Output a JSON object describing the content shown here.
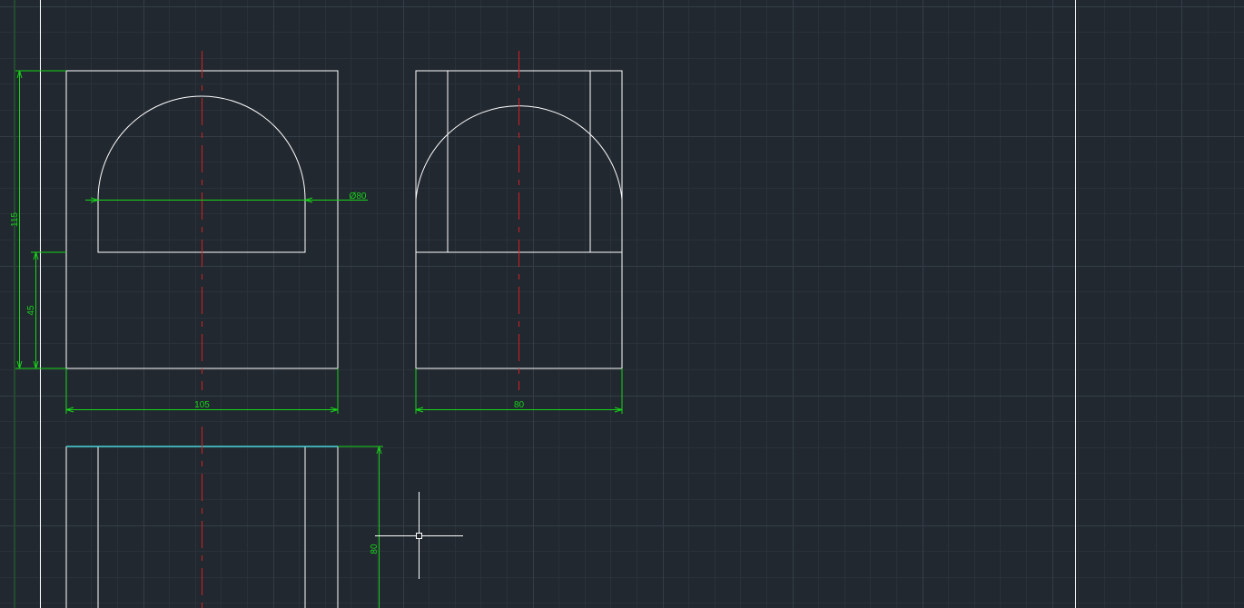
{
  "colors": {
    "background": "#212830",
    "grid_minor": "#2a3139",
    "grid_major": "#343d46",
    "geometry": "#ffffff",
    "center_line": "#d42020",
    "dimension": "#18d418",
    "selected_edge": "#48d8d8",
    "cursor": "#ffffff"
  },
  "dimensions": {
    "front_width": "105",
    "front_height": "115",
    "front_slot_height": "45",
    "bore_diameter": "Ø80",
    "side_width": "80",
    "top_depth": "80"
  },
  "icons": {
    "cursor": "crosshair-cursor-icon"
  }
}
